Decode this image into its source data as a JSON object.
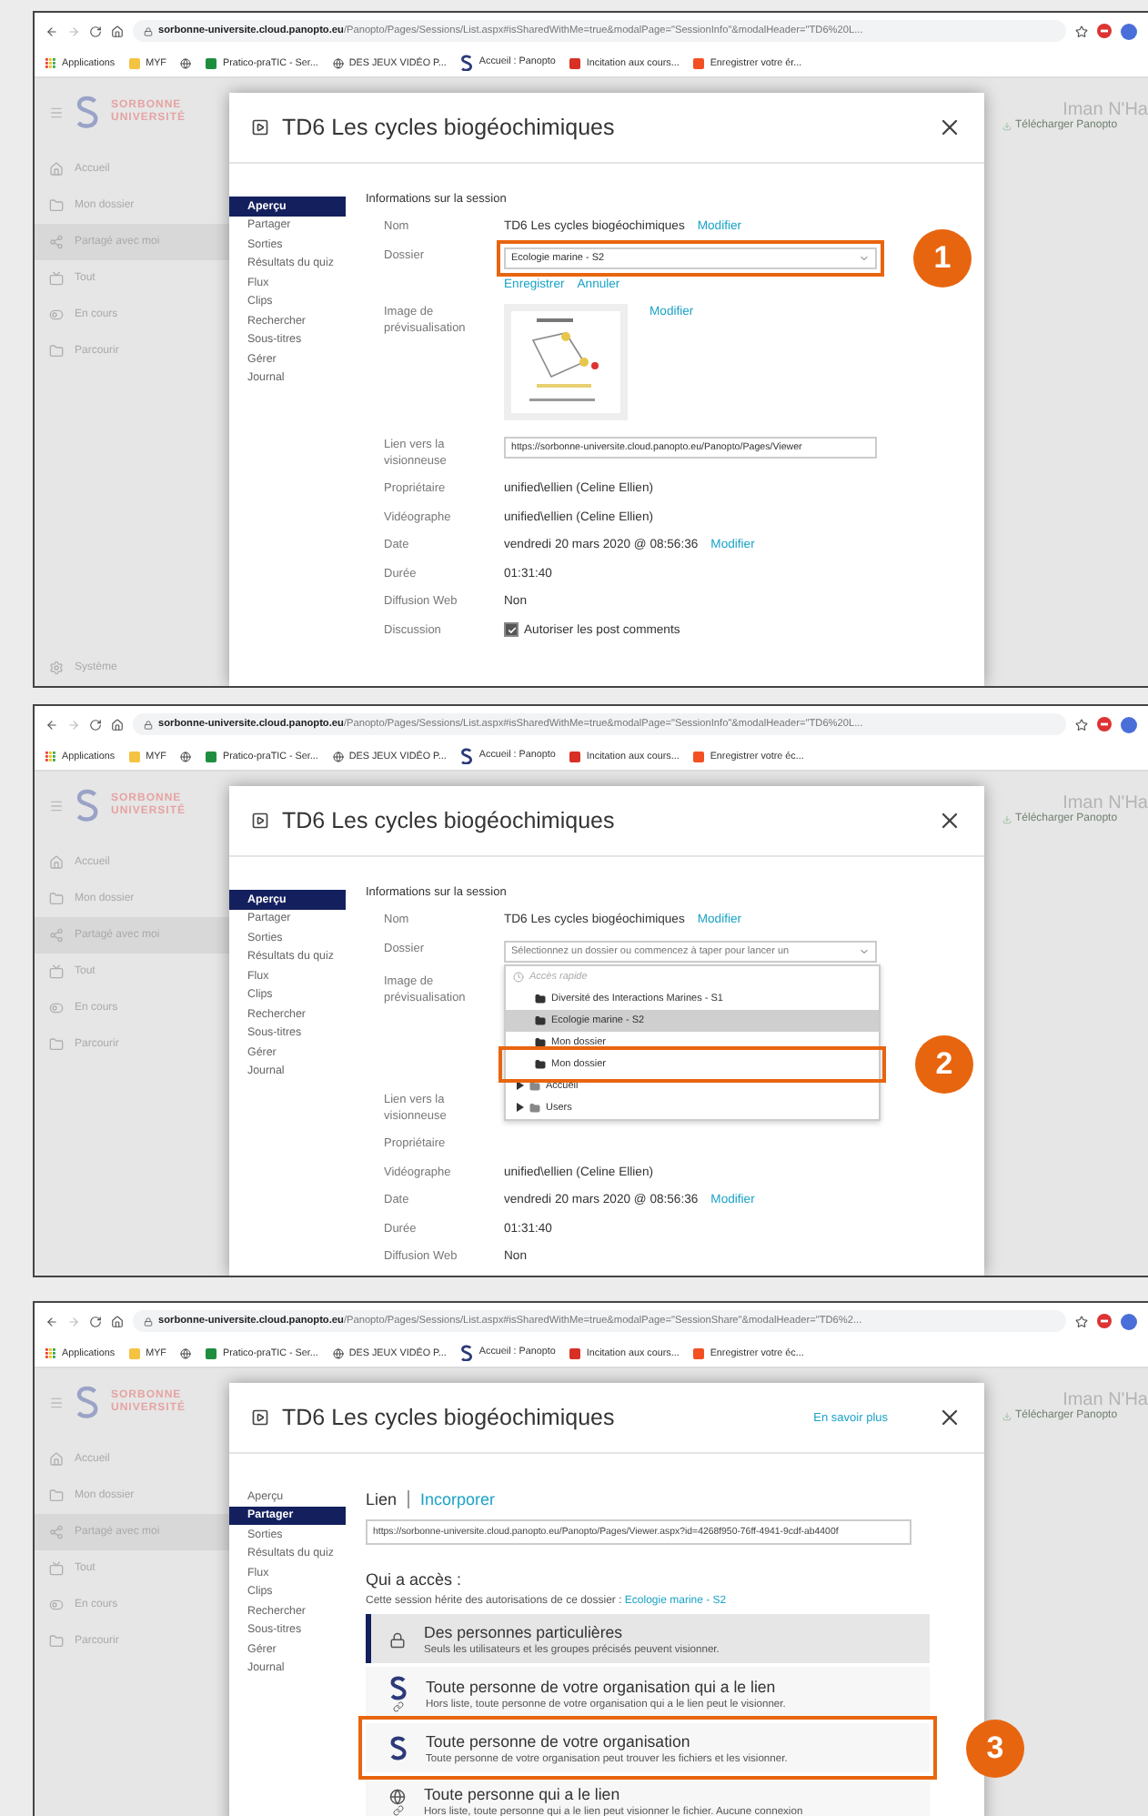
{
  "panels": [
    {
      "browser": {
        "host": "sorbonne-universite.cloud.panopto.eu",
        "path": "/Panopto/Pages/Sessions/List.aspx#isSharedWithMe=true&modalPage=\"SessionInfo\"&modalHeader=\"TD6%20L...",
        "bookmarks": [
          {
            "kind": "apps",
            "label": "Applications"
          },
          {
            "kind": "folder",
            "label": "MYF"
          },
          {
            "kind": "globe"
          },
          {
            "kind": "sheet",
            "label": "Pratico-praTIC - Ser..."
          },
          {
            "kind": "globe",
            "label": "DES JEUX VIDÉO P..."
          },
          {
            "kind": "panopto",
            "label": "Accueil : Panopto"
          },
          {
            "kind": "doc",
            "label": "Incitation aux cours..."
          },
          {
            "kind": "ms",
            "label": "Enregistrer votre ér..."
          }
        ]
      },
      "app": {
        "logo": [
          "SORBONNE",
          "UNIVERSITÉ"
        ],
        "nav": [
          {
            "kind": "home",
            "label": "Accueil",
            "selected": false
          },
          {
            "kind": "folder",
            "label": "Mon dossier",
            "selected": false
          },
          {
            "kind": "share",
            "label": "Partagé avec moi",
            "selected": true
          },
          {
            "kind": "tv",
            "label": "Tout",
            "selected": false
          },
          {
            "kind": "live",
            "label": "En cours",
            "selected": false
          },
          {
            "kind": "browse",
            "label": "Parcourir",
            "selected": false
          }
        ],
        "footer": "Système",
        "user": "Iman N'Ha",
        "download": "Télécharger Panopto"
      },
      "modal": {
        "title": "TD6 Les cycles biogéochimiques",
        "tabs": [
          {
            "label": "Aperçu",
            "selected": true
          },
          {
            "label": "Partager",
            "selected": false
          },
          {
            "label": "Sorties",
            "selected": false
          },
          {
            "label": "Résultats du quiz",
            "selected": false
          },
          {
            "label": "Flux",
            "selected": false
          },
          {
            "label": "Clips",
            "selected": false
          },
          {
            "label": "Rechercher",
            "selected": false
          },
          {
            "label": "Sous-titres",
            "selected": false
          },
          {
            "label": "Gérer",
            "selected": false
          },
          {
            "label": "Journal",
            "selected": false
          }
        ],
        "content": {
          "kind": "info",
          "heading": "Informations sur la session",
          "rows": [
            {
              "kind": "text",
              "label": "Nom",
              "value": "TD6 Les cycles biogéochimiques",
              "link": "Modifier"
            },
            {
              "kind": "select",
              "label": "Dossier",
              "value": "Ecologie marine - S2",
              "actions": [
                "Enregistrer",
                "Annuler"
              ],
              "outlined": true,
              "callout": "1"
            },
            {
              "kind": "image",
              "label": "Image de prévisualisation",
              "link": "Modifier"
            },
            {
              "kind": "url",
              "label": "Lien vers la visionneuse",
              "value": "https://sorbonne-universite.cloud.panopto.eu/Panopto/Pages/Viewer"
            },
            {
              "kind": "text",
              "label": "Propriétaire",
              "value": "unified\\ellien (Celine Ellien)"
            },
            {
              "kind": "text",
              "label": "Vidéographe",
              "value": "unified\\ellien (Celine Ellien)"
            },
            {
              "kind": "text",
              "label": "Date",
              "value": "vendredi 20 mars 2020 @ 08:56:36",
              "link": "Modifier"
            },
            {
              "kind": "text",
              "label": "Durée",
              "value": "01:31:40"
            },
            {
              "kind": "text",
              "label": "Diffusion Web",
              "value": "Non"
            },
            {
              "kind": "checkbox",
              "label": "Discussion",
              "value": "Autoriser les post comments",
              "checked": true
            }
          ]
        }
      }
    },
    {
      "browser": {
        "host": "sorbonne-universite.cloud.panopto.eu",
        "path": "/Panopto/Pages/Sessions/List.aspx#isSharedWithMe=true&modalPage=\"SessionInfo\"&modalHeader=\"TD6%20L...",
        "bookmarks": [
          {
            "kind": "apps",
            "label": "Applications"
          },
          {
            "kind": "folder",
            "label": "MYF"
          },
          {
            "kind": "globe"
          },
          {
            "kind": "sheet",
            "label": "Pratico-praTIC - Ser..."
          },
          {
            "kind": "globe",
            "label": "DES JEUX VIDÉO P..."
          },
          {
            "kind": "panopto",
            "label": "Accueil : Panopto"
          },
          {
            "kind": "doc",
            "label": "Incitation aux cours..."
          },
          {
            "kind": "ms",
            "label": "Enregistrer votre éc..."
          }
        ]
      },
      "app": {
        "logo": [
          "SORBONNE",
          "UNIVERSITÉ"
        ],
        "nav": [
          {
            "kind": "home",
            "label": "Accueil",
            "selected": false
          },
          {
            "kind": "folder",
            "label": "Mon dossier",
            "selected": false
          },
          {
            "kind": "share",
            "label": "Partagé avec moi",
            "selected": true
          },
          {
            "kind": "tv",
            "label": "Tout",
            "selected": false
          },
          {
            "kind": "live",
            "label": "En cours",
            "selected": false
          },
          {
            "kind": "browse",
            "label": "Parcourir",
            "selected": false
          }
        ],
        "user": "Iman N'Ha",
        "download": "Télécharger Panopto"
      },
      "modal": {
        "title": "TD6 Les cycles biogéochimiques",
        "tabs": [
          {
            "label": "Aperçu",
            "selected": true
          },
          {
            "label": "Partager",
            "selected": false
          },
          {
            "label": "Sorties",
            "selected": false
          },
          {
            "label": "Résultats du quiz",
            "selected": false
          },
          {
            "label": "Flux",
            "selected": false
          },
          {
            "label": "Clips",
            "selected": false
          },
          {
            "label": "Rechercher",
            "selected": false
          },
          {
            "label": "Sous-titres",
            "selected": false
          },
          {
            "label": "Gérer",
            "selected": false
          },
          {
            "label": "Journal",
            "selected": false
          }
        ],
        "content": {
          "kind": "info",
          "heading": "Informations sur la session",
          "rows": [
            {
              "kind": "text",
              "label": "Nom",
              "value": "TD6 Les cycles biogéochimiques",
              "link": "Modifier"
            },
            {
              "kind": "select",
              "label": "Dossier",
              "placeholder": "Sélectionnez un dossier ou commencez à taper pour lancer un",
              "options": [
                {
                  "kind": "header",
                  "label": "Accès rapide"
                },
                {
                  "kind": "folder",
                  "label": "Diversité des Interactions Marines - S1",
                  "selected": false
                },
                {
                  "kind": "folder",
                  "label": "Ecologie marine - S2",
                  "selected": true
                },
                {
                  "kind": "folder",
                  "label": "Mon dossier",
                  "selected": false
                },
                {
                  "kind": "folder",
                  "label": "Mon dossier",
                  "selected": false,
                  "outlined": true,
                  "callout": "2"
                },
                {
                  "kind": "tree",
                  "label": "Accueil",
                  "selected": false
                },
                {
                  "kind": "tree",
                  "label": "Users",
                  "selected": false
                }
              ]
            },
            {
              "kind": "label",
              "label": "Image de prévisualisation"
            },
            {
              "kind": "label",
              "label": "Lien vers la visionneuse"
            },
            {
              "kind": "label",
              "label": "Propriétaire"
            },
            {
              "kind": "text",
              "label": "Vidéographe",
              "value": "unified\\ellien (Celine Ellien)"
            },
            {
              "kind": "text",
              "label": "Date",
              "value": "vendredi 20 mars 2020 @ 08:56:36",
              "link": "Modifier"
            },
            {
              "kind": "text",
              "label": "Durée",
              "value": "01:31:40"
            },
            {
              "kind": "text",
              "label": "Diffusion Web",
              "value": "Non"
            }
          ]
        }
      }
    },
    {
      "browser": {
        "host": "sorbonne-universite.cloud.panopto.eu",
        "path": "/Panopto/Pages/Sessions/List.aspx#isSharedWithMe=true&modalPage=\"SessionShare\"&modalHeader=\"TD6%2...",
        "bookmarks": [
          {
            "kind": "apps",
            "label": "Applications"
          },
          {
            "kind": "folder",
            "label": "MYF"
          },
          {
            "kind": "globe"
          },
          {
            "kind": "sheet",
            "label": "Pratico-praTIC - Ser..."
          },
          {
            "kind": "globe",
            "label": "DES JEUX VIDÉO P..."
          },
          {
            "kind": "panopto",
            "label": "Accueil : Panopto"
          },
          {
            "kind": "doc",
            "label": "Incitation aux cours..."
          },
          {
            "kind": "ms",
            "label": "Enregistrer votre éc..."
          }
        ]
      },
      "app": {
        "logo": [
          "SORBONNE",
          "UNIVERSITÉ"
        ],
        "nav": [
          {
            "kind": "home",
            "label": "Accueil",
            "selected": false
          },
          {
            "kind": "folder",
            "label": "Mon dossier",
            "selected": false
          },
          {
            "kind": "share",
            "label": "Partagé avec moi",
            "selected": true
          },
          {
            "kind": "tv",
            "label": "Tout",
            "selected": false
          },
          {
            "kind": "live",
            "label": "En cours",
            "selected": false
          },
          {
            "kind": "browse",
            "label": "Parcourir",
            "selected": false
          }
        ],
        "user": "Iman N'Ha",
        "download": "Télécharger Panopto"
      },
      "modal": {
        "title": "TD6 Les cycles biogéochimiques",
        "help": "En savoir plus",
        "tabs": [
          {
            "label": "Aperçu",
            "selected": false
          },
          {
            "label": "Partager",
            "selected": true
          },
          {
            "label": "Sorties",
            "selected": false
          },
          {
            "label": "Résultats du quiz",
            "selected": false
          },
          {
            "label": "Flux",
            "selected": false
          },
          {
            "label": "Clips",
            "selected": false
          },
          {
            "label": "Rechercher",
            "selected": false
          },
          {
            "label": "Sous-titres",
            "selected": false
          },
          {
            "label": "Gérer",
            "selected": false
          },
          {
            "label": "Journal",
            "selected": false
          }
        ],
        "content": {
          "kind": "share",
          "modes": [
            {
              "label": "Lien",
              "selected": true
            },
            {
              "label": "Incorporer",
              "selected": false
            }
          ],
          "url": "https://sorbonne-universite.cloud.panopto.eu/Panopto/Pages/Viewer.aspx?id=4268f950-76ff-4941-9cdf-ab4400f",
          "heading": "Qui a accès :",
          "inherit": "Cette session hérite des autorisations de ce dossier : ",
          "folder": "Ecologie marine - S2",
          "options": [
            {
              "kind": "lock",
              "title": "Des personnes particulières",
              "desc": "Seuls les utilisateurs et les groupes précisés peuvent visionner.",
              "selected": true
            },
            {
              "kind": "org-link",
              "title": "Toute personne de votre organisation qui a le lien",
              "desc": "Hors liste, toute personne de votre organisation qui a le lien peut le visionner.",
              "selected": false
            },
            {
              "kind": "org",
              "title": "Toute personne de votre organisation",
              "desc": "Toute personne de votre organisation peut trouver les fichiers et les visionner.",
              "selected": false,
              "outlined": true,
              "callout": "3"
            },
            {
              "kind": "globe-link",
              "title": "Toute personne qui a le lien",
              "desc": "Hors liste, toute personne qui a le lien peut visionner le fichier. Aucune connexion",
              "selected": false
            }
          ]
        }
      }
    }
  ]
}
